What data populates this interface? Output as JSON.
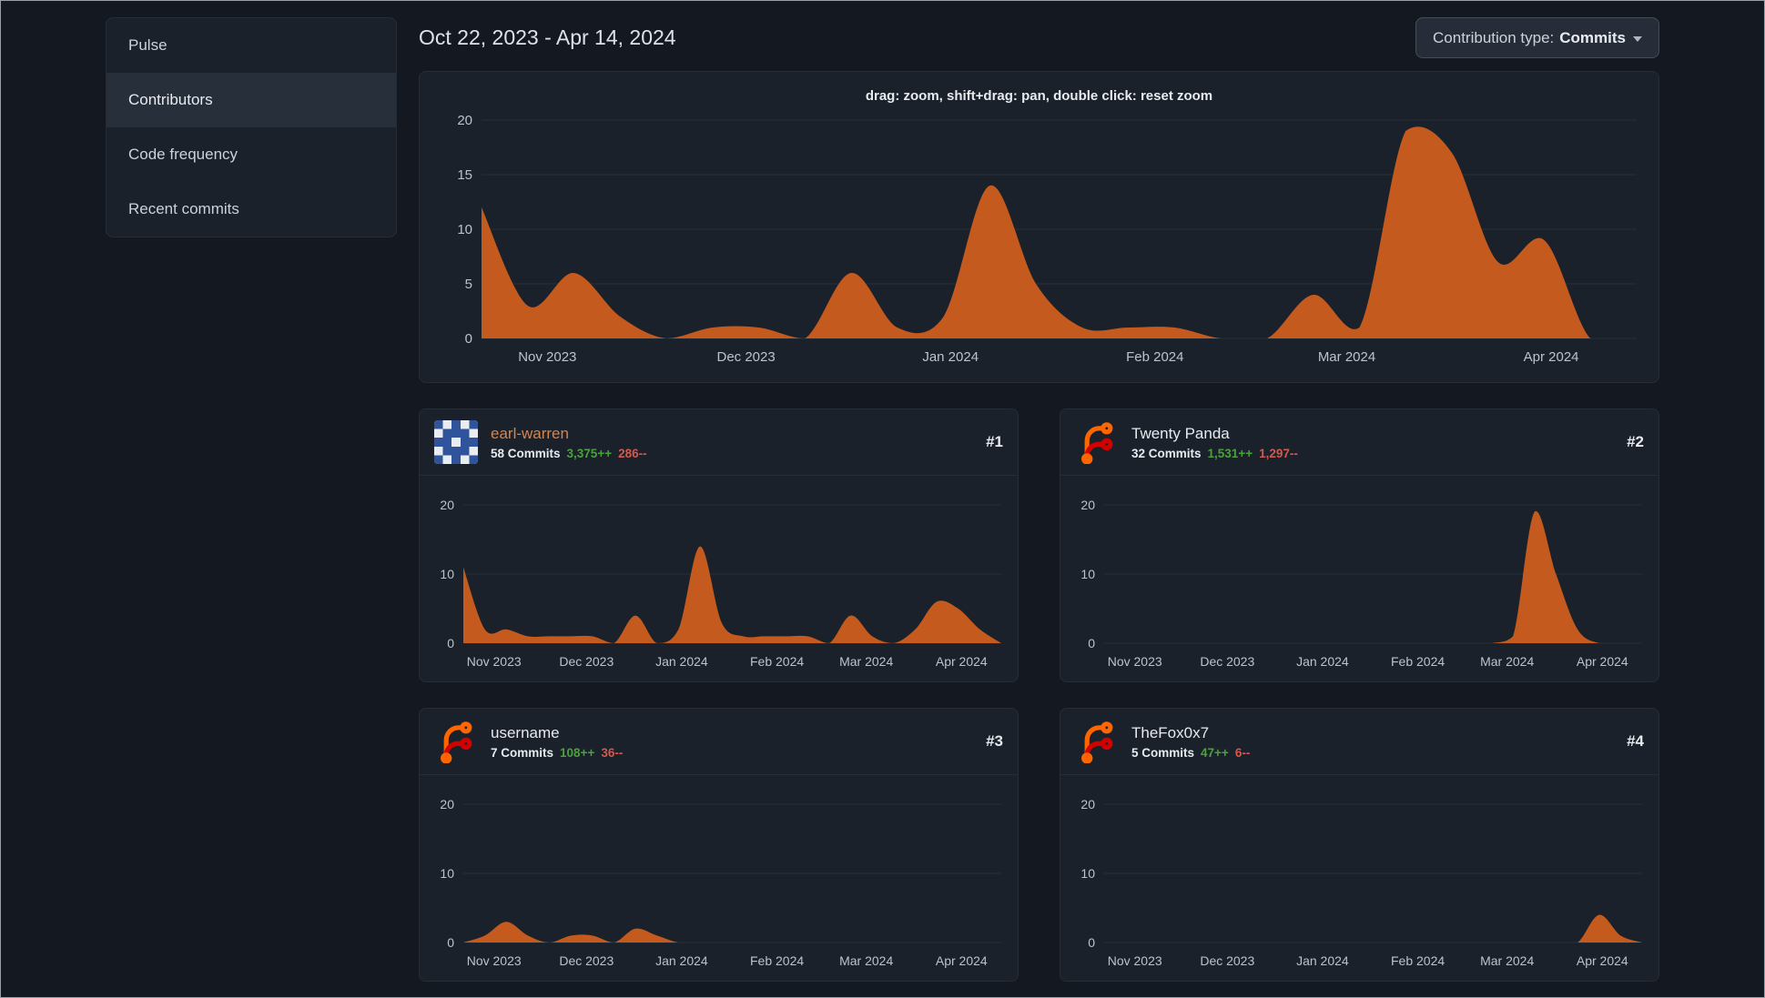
{
  "colors": {
    "page_bg": "#141921",
    "panel_bg": "#1a212a",
    "panel_active": "#272f3a",
    "border": "#262d37",
    "text_primary": "#dde1e7",
    "accent_orange": "#c45a1d",
    "additions_green": "#4ba13e",
    "deletions_red": "#d05a4f",
    "link_orange": "#d8834b"
  },
  "sidebar": {
    "items": [
      {
        "label": "Pulse",
        "active": false
      },
      {
        "label": "Contributors",
        "active": true
      },
      {
        "label": "Code frequency",
        "active": false
      },
      {
        "label": "Recent commits",
        "active": false
      }
    ]
  },
  "header": {
    "date_range": "Oct 22, 2023 - Apr 14, 2024",
    "filter_label": "Contribution type:",
    "filter_value": "Commits"
  },
  "contributors": [
    {
      "rank": "#1",
      "name": "earl-warren",
      "commits": "58 Commits",
      "additions": "3,375++",
      "deletions": "286--",
      "avatar": "identicon"
    },
    {
      "rank": "#2",
      "name": "Twenty Panda",
      "commits": "32 Commits",
      "additions": "1,531++",
      "deletions": "1,297--",
      "avatar": "forgejo-logo"
    },
    {
      "rank": "#3",
      "name": "username",
      "commits": "7 Commits",
      "additions": "108++",
      "deletions": "36--",
      "avatar": "forgejo-logo"
    },
    {
      "rank": "#4",
      "name": "TheFox0x7",
      "commits": "5 Commits",
      "additions": "47++",
      "deletions": "6--",
      "avatar": "forgejo-logo"
    }
  ],
  "chart_data": [
    {
      "type": "area",
      "name": "total-contributions",
      "note": "drag: zoom, shift+drag: pan, double click: reset zoom",
      "x_unit": "week",
      "x_range": [
        "Oct 22, 2023",
        "Apr 14, 2024"
      ],
      "values": [
        12,
        3,
        6,
        2,
        0,
        1,
        1,
        0,
        6,
        1,
        2,
        14,
        5,
        1,
        1,
        1,
        0,
        0,
        4,
        1,
        19,
        17,
        7,
        9,
        0,
        0
      ],
      "ylim": [
        0,
        20
      ],
      "y_ticks": [
        0,
        5,
        10,
        15,
        20
      ],
      "x_labels": [
        {
          "label": "Nov 2023",
          "pos": 0.057
        },
        {
          "label": "Dec 2023",
          "pos": 0.229
        },
        {
          "label": "Jan 2024",
          "pos": 0.406
        },
        {
          "label": "Feb 2024",
          "pos": 0.583
        },
        {
          "label": "Mar 2024",
          "pos": 0.749
        },
        {
          "label": "Apr 2024",
          "pos": 0.926
        }
      ],
      "grid": true,
      "legend": "none",
      "color": "#c45a1d"
    },
    {
      "type": "area",
      "name": "earl-warren-commits",
      "values": [
        11,
        2,
        2,
        1,
        1,
        1,
        1,
        0,
        4,
        0,
        2,
        14,
        3,
        1,
        1,
        1,
        1,
        0,
        4,
        1,
        0,
        2,
        6,
        5,
        2,
        0
      ],
      "ylim": [
        0,
        20
      ],
      "y_ticks": [
        0,
        10,
        20
      ],
      "x_labels": [
        {
          "label": "Nov 2023",
          "pos": 0.057
        },
        {
          "label": "Dec 2023",
          "pos": 0.229
        },
        {
          "label": "Jan 2024",
          "pos": 0.406
        },
        {
          "label": "Feb 2024",
          "pos": 0.583
        },
        {
          "label": "Mar 2024",
          "pos": 0.749
        },
        {
          "label": "Apr 2024",
          "pos": 0.926
        }
      ],
      "grid": true,
      "legend": "none",
      "color": "#c45a1d"
    },
    {
      "type": "area",
      "name": "twenty-panda-commits",
      "values": [
        0,
        0,
        0,
        0,
        0,
        0,
        0,
        0,
        0,
        0,
        0,
        0,
        0,
        0,
        0,
        0,
        0,
        0,
        0,
        1,
        19,
        10,
        2,
        0,
        0,
        0
      ],
      "ylim": [
        0,
        20
      ],
      "y_ticks": [
        0,
        10,
        20
      ],
      "x_labels": [
        {
          "label": "Nov 2023",
          "pos": 0.057
        },
        {
          "label": "Dec 2023",
          "pos": 0.229
        },
        {
          "label": "Jan 2024",
          "pos": 0.406
        },
        {
          "label": "Feb 2024",
          "pos": 0.583
        },
        {
          "label": "Mar 2024",
          "pos": 0.749
        },
        {
          "label": "Apr 2024",
          "pos": 0.926
        }
      ],
      "grid": true,
      "legend": "none",
      "color": "#c45a1d"
    },
    {
      "type": "area",
      "name": "username-commits",
      "values": [
        0,
        1,
        3,
        1,
        0,
        1,
        1,
        0,
        2,
        1,
        0,
        0,
        0,
        0,
        0,
        0,
        0,
        0,
        0,
        0,
        0,
        0,
        0,
        0,
        0,
        0
      ],
      "ylim": [
        0,
        20
      ],
      "y_ticks": [
        0,
        10,
        20
      ],
      "x_labels": [
        {
          "label": "Nov 2023",
          "pos": 0.057
        },
        {
          "label": "Dec 2023",
          "pos": 0.229
        },
        {
          "label": "Jan 2024",
          "pos": 0.406
        },
        {
          "label": "Feb 2024",
          "pos": 0.583
        },
        {
          "label": "Mar 2024",
          "pos": 0.749
        },
        {
          "label": "Apr 2024",
          "pos": 0.926
        }
      ],
      "grid": true,
      "legend": "none",
      "color": "#c45a1d"
    },
    {
      "type": "area",
      "name": "thefox0x7-commits",
      "values": [
        0,
        0,
        0,
        0,
        0,
        0,
        0,
        0,
        0,
        0,
        0,
        0,
        0,
        0,
        0,
        0,
        0,
        0,
        0,
        0,
        0,
        0,
        0,
        4,
        1,
        0
      ],
      "ylim": [
        0,
        20
      ],
      "y_ticks": [
        0,
        10,
        20
      ],
      "x_labels": [
        {
          "label": "Nov 2023",
          "pos": 0.057
        },
        {
          "label": "Dec 2023",
          "pos": 0.229
        },
        {
          "label": "Jan 2024",
          "pos": 0.406
        },
        {
          "label": "Feb 2024",
          "pos": 0.583
        },
        {
          "label": "Mar 2024",
          "pos": 0.749
        },
        {
          "label": "Apr 2024",
          "pos": 0.926
        }
      ],
      "grid": true,
      "legend": "none",
      "color": "#c45a1d"
    }
  ]
}
